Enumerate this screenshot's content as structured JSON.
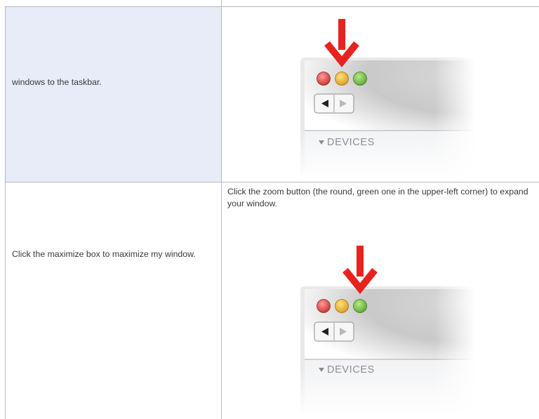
{
  "rows": [
    {
      "left_text": "windows to the taskbar.",
      "right_text": "",
      "image": {
        "devices_label": "DEVICES",
        "highlighted_button": "minimize",
        "arrow_color": "#e8231f"
      }
    },
    {
      "left_text": "Click the maximize box to maximize my window.",
      "right_text": "Click the zoom button (the round, green one in the upper-left corner) to expand your window.",
      "image": {
        "devices_label": "DEVICES",
        "highlighted_button": "zoom",
        "arrow_color": "#e8231f"
      }
    }
  ],
  "colors": {
    "left_cell_bg": "#e8ecf8",
    "border": "#b4b9c6"
  }
}
